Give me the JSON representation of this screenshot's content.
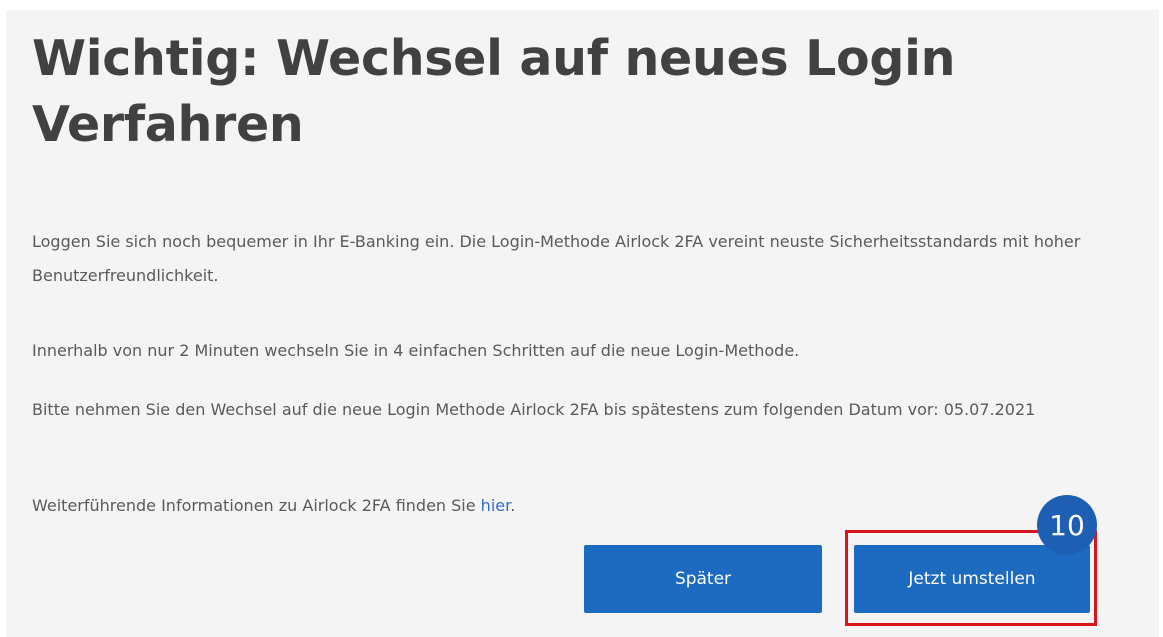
{
  "dialog": {
    "title": "Wichtig: Wechsel auf neues Login Verfahren",
    "paragraph_1": "Loggen Sie sich noch bequemer in Ihr E-Banking ein. Die Login-Methode Airlock 2FA vereint neuste Sicherheitsstandards mit hoher Benutzerfreundlichkeit.",
    "paragraph_2": "Innerhalb von nur 2 Minuten wechseln Sie in 4 einfachen Schritten auf die neue Login-Methode.",
    "paragraph_3": "Bitte nehmen Sie den Wechsel auf die neue Login Methode Airlock 2FA bis spätestens zum folgenden Datum vor: 05.07.2021",
    "info_prefix": "Weiterführende Informationen zu Airlock 2FA finden Sie ",
    "info_link": "hier",
    "info_suffix": "."
  },
  "buttons": {
    "later_label": "Später",
    "switch_label": "Jetzt umstellen"
  },
  "annotation": {
    "step_number": "10",
    "highlight_color": "#d9151b",
    "badge_color": "#1e5fb3"
  },
  "colors": {
    "panel_background": "#f4f4f4",
    "button_blue": "#1d6bc1",
    "link_blue": "#2f6fc4",
    "title_text": "#414141",
    "body_text": "#5a5a5a"
  }
}
